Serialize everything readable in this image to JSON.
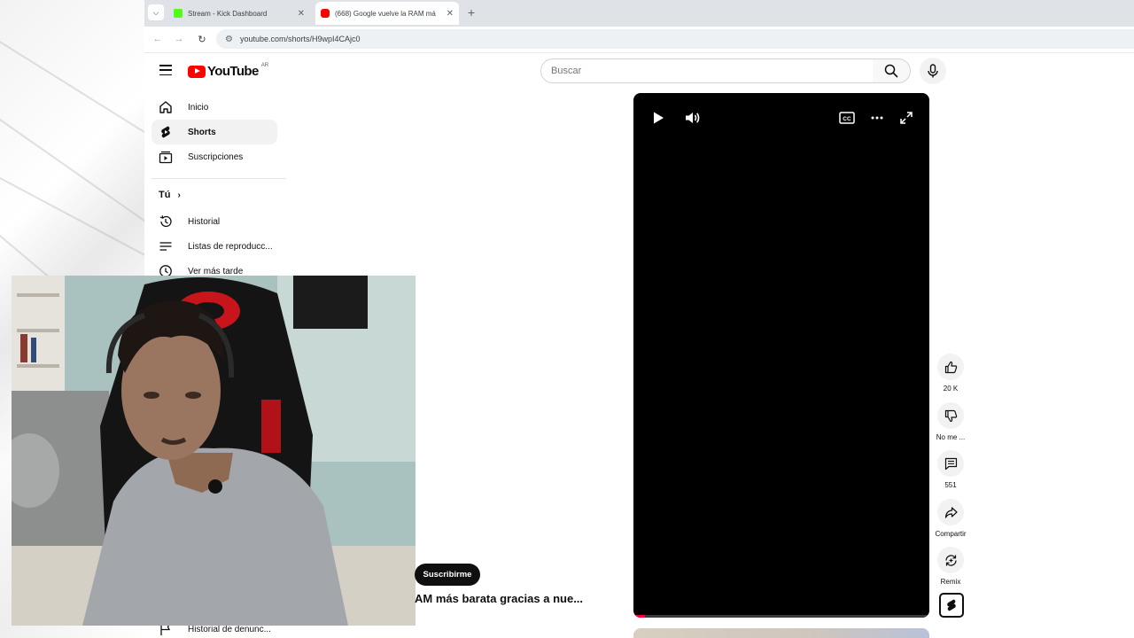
{
  "browser": {
    "tabs": [
      {
        "title": "Stream - Kick Dashboard",
        "favicon_color": "#53fc18"
      },
      {
        "title": "(668) Google vuelve la RAM má",
        "favicon_color": "#ff0000"
      }
    ],
    "url": "youtube.com/shorts/H9wpI4CAjc0"
  },
  "youtube": {
    "logo_text": "YouTube",
    "country_code": "AR",
    "search_placeholder": "Buscar",
    "sidebar": {
      "items": [
        {
          "label": "Inicio",
          "icon": "home-icon"
        },
        {
          "label": "Shorts",
          "icon": "shorts-icon",
          "active": true
        },
        {
          "label": "Suscripciones",
          "icon": "subscriptions-icon"
        }
      ],
      "you_section": {
        "title": "Tú",
        "items": [
          {
            "label": "Historial",
            "icon": "history-icon"
          },
          {
            "label": "Listas de reproducc...",
            "icon": "playlists-icon"
          },
          {
            "label": "Ver más tarde",
            "icon": "watch-later-icon"
          }
        ]
      },
      "report_history": {
        "label": "Historial de denunc...",
        "icon": "flag-icon"
      }
    },
    "short": {
      "subscribe_label": "Suscribirme",
      "title": "AM más barata gracias a nue...",
      "progress": 0.04,
      "actions": {
        "like_count": "20 K",
        "dislike_label": "No me ...",
        "comments_count": "551",
        "share_label": "Compartir",
        "remix_label": "Remix"
      }
    }
  },
  "colors": {
    "brand_red": "#ff0000",
    "text_primary": "#0f0f0f",
    "chip_bg": "#f2f2f2"
  }
}
